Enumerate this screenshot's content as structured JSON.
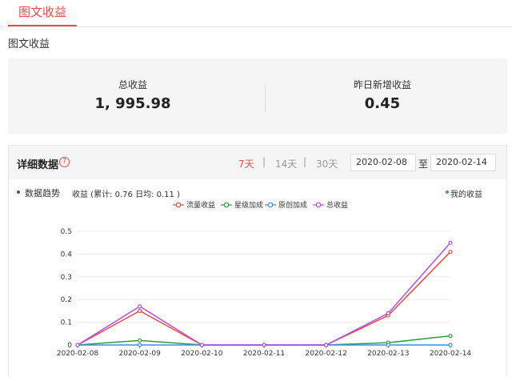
{
  "tabs": {
    "active_label": "图文收益"
  },
  "section_title": "图文收益",
  "summary": {
    "total_label": "总收益",
    "total_value": "1, 995.98",
    "yesterday_label": "昨日新增收益",
    "yesterday_value": "0.45"
  },
  "detail": {
    "title": "详细数据",
    "help_icon": "?",
    "ranges": [
      "7天",
      "14天",
      "30天"
    ],
    "separator": "|",
    "start_date": "2020-02-08",
    "to_label": "至",
    "end_date": "2020-02-14",
    "trend_label": "数据趋势",
    "trend_info": "收益 (累计: 0.76 日均: 0.11 )",
    "my_income_label": "我的收益"
  },
  "colors": {
    "accent": "#e2504a",
    "series_flow": "#e2504a",
    "series_star": "#2e9e3a",
    "series_original": "#3d8fe0",
    "series_total": "#b84de8"
  },
  "chart_data": {
    "type": "line",
    "x": [
      "2020-02-08",
      "2020-02-09",
      "2020-02-10",
      "2020-02-11",
      "2020-02-12",
      "2020-02-13",
      "2020-02-14"
    ],
    "series": [
      {
        "name": "流量收益",
        "values": [
          0,
          0.15,
          0,
          0,
          0,
          0.13,
          0.41
        ]
      },
      {
        "name": "星级加成",
        "values": [
          0,
          0.02,
          0,
          0,
          0,
          0.01,
          0.04
        ]
      },
      {
        "name": "原创加成",
        "values": [
          0,
          0,
          0,
          0,
          0,
          0,
          0
        ]
      },
      {
        "name": "总收益",
        "values": [
          0,
          0.17,
          0,
          0,
          0,
          0.14,
          0.45
        ]
      }
    ],
    "yticks": [
      0,
      0.1,
      0.2,
      0.3,
      0.4,
      0.5
    ],
    "ylim": [
      0,
      0.5
    ],
    "grid": true,
    "legend": "top-center"
  }
}
